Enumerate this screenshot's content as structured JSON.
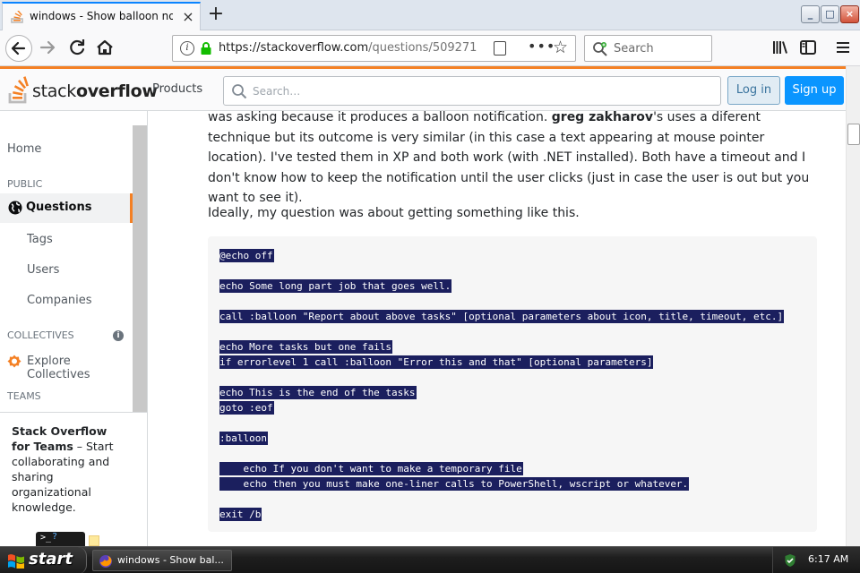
{
  "browser": {
    "tab_title": "windows - Show balloon notifi",
    "new_tab": "+",
    "tab_close": "×",
    "url_host": "https://stackoverflow.com",
    "url_path": "/questions/509271",
    "search_placeholder": "Search",
    "window_buttons": {
      "minimize": "_",
      "maximize": "□",
      "close": "×"
    }
  },
  "so_header": {
    "logo_text_light": "stack",
    "logo_text_bold": "overflow",
    "products": "Products",
    "search_placeholder": "Search…",
    "login": "Log in",
    "signup": "Sign up"
  },
  "left_nav": {
    "home": "Home",
    "public_heading": "PUBLIC",
    "questions": "Questions",
    "tags": "Tags",
    "users": "Users",
    "companies": "Companies",
    "collectives_heading": "COLLECTIVES",
    "info": "i",
    "explore_collectives": "Explore Collectives",
    "teams_heading": "TEAMS",
    "teams_title": "Stack Overflow for Teams",
    "teams_body": " – Start collaborating and sharing organizational knowledge.",
    "terminal_prompt": ">_",
    "terminal_q": "?"
  },
  "content": {
    "p1_a": "was asking because it produces a balloon notification. ",
    "p1_bold": "greg zakharov",
    "p1_b": "'s uses a diferent technique but its outcome is very similar (in this case a text appearing at mouse pointer location). I've tested them in XP and both work (with .NET installed). Both have a timeout and I don't know how to keep the notification until the user clicks (just in case the user is out but you want to see it).",
    "p2": "Ideally, my question was about getting something like this.",
    "code_lines": [
      "@echo off",
      "echo Some long part job that goes well.",
      "call :balloon \"Report about above tasks\" [optional parameters about icon, title, timeout, etc.]",
      "echo More tasks but one fails",
      "if errorlevel 1 call :balloon \"Error this and that\" [optional parameters]",
      "echo This is the end of the tasks",
      "goto :eof",
      ":balloon",
      "    echo If you don't want to make a temporary file",
      "    echo then you must make one-liner calls to PowerShell, wscript or whatever.",
      "exit /b"
    ]
  },
  "taskbar": {
    "start": "start",
    "task_label": "windows - Show bal...",
    "clock": "6:17 AM"
  },
  "icons": [
    "stackoverflow-favicon",
    "back-arrow-icon",
    "forward-arrow-icon",
    "reload-icon",
    "home-icon",
    "info-icon",
    "lock-icon",
    "reader-view-icon",
    "more-icon",
    "star-icon",
    "search-icon",
    "library-icon",
    "sidebar-icon",
    "hamburger-menu-icon",
    "globe-icon",
    "collectives-icon",
    "windows-flag-icon",
    "firefox-icon",
    "security-shield-icon"
  ],
  "colors": {
    "so_orange": "#f48024",
    "so_blue": "#0a95ff",
    "selection": "#1b1f5e",
    "firefox_tab_accent": "#0a84ff"
  }
}
